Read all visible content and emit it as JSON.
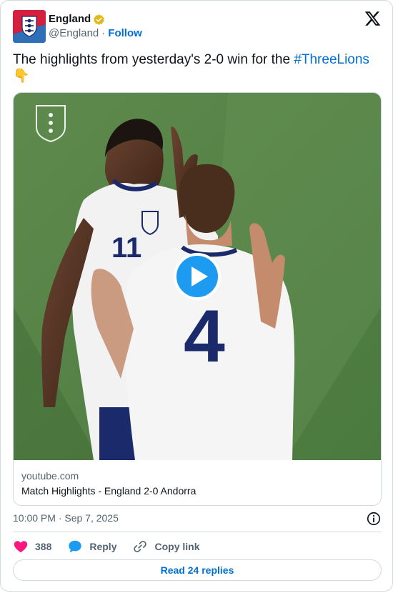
{
  "author": {
    "display_name": "England",
    "handle": "@England",
    "separator": "·",
    "follow_label": "Follow"
  },
  "tweet": {
    "text": "The highlights from yesterday's 2-0 win for the ",
    "hashtag": "#ThreeLions",
    "emoji": "👇"
  },
  "media": {
    "domain": "youtube.com",
    "title": "Match Highlights - England 2-0 Andorra",
    "player_numbers": [
      "11",
      "4"
    ]
  },
  "meta": {
    "timestamp": "10:00 PM · Sep 7, 2025"
  },
  "actions": {
    "likes": "388",
    "reply_label": "Reply",
    "copy_label": "Copy link"
  },
  "footer": {
    "read_replies_label": "Read 24 replies"
  },
  "colors": {
    "link_blue": "#006fd6",
    "like_pink": "#f91880",
    "reply_blue": "#1d9bf0",
    "verified_gold": "#e2b719",
    "secondary_text": "#536471",
    "border": "#cfd9de"
  },
  "icons": [
    "england-crest-avatar",
    "verified-badge-icon",
    "x-logo-icon",
    "play-icon",
    "info-icon",
    "heart-icon",
    "reply-bubble-icon",
    "link-icon"
  ]
}
